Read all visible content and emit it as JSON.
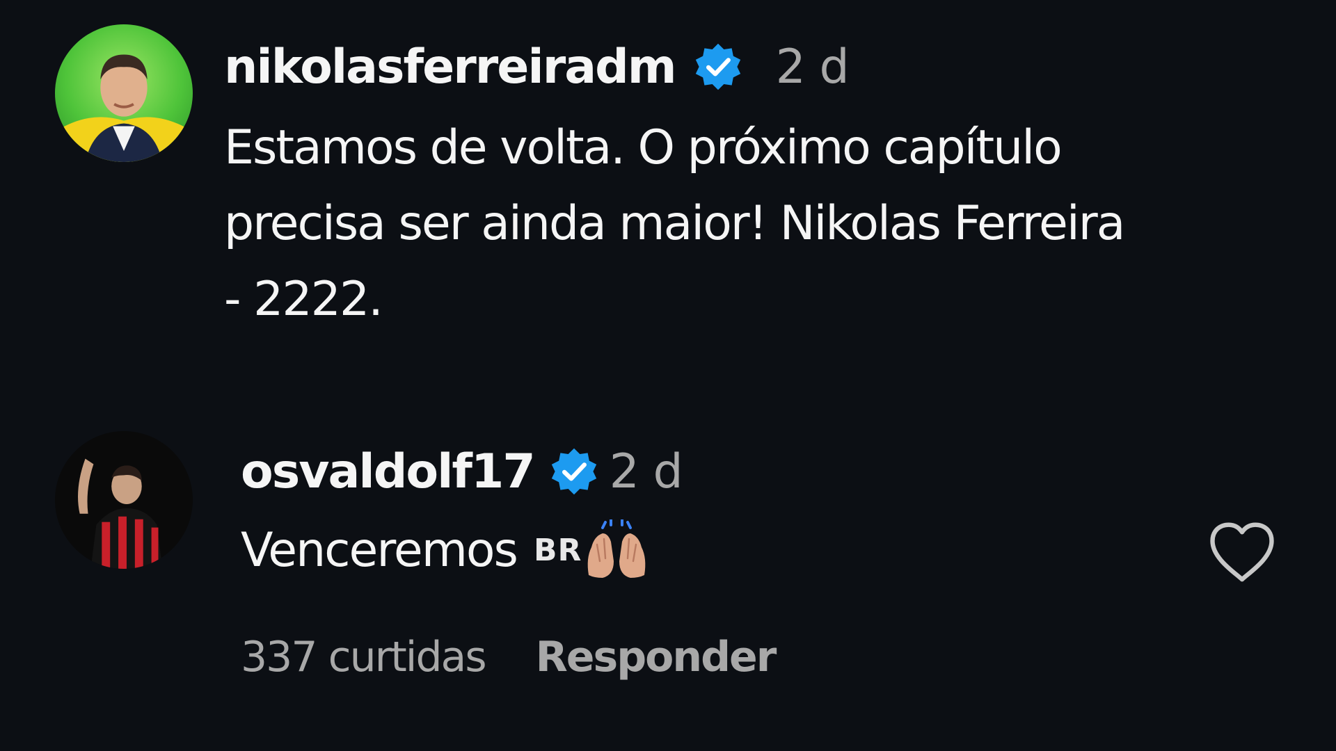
{
  "caption": {
    "username": "nikolasferreiradm",
    "verified": true,
    "timestamp": "2 d",
    "text": "Estamos de volta. O próximo capítulo\nprecisa ser ainda maior! Nikolas Ferreira\n- 2222."
  },
  "comment": {
    "username": "osvaldolf17",
    "verified": true,
    "timestamp": "2 d",
    "text": "Venceremos",
    "flag_letters": "BR",
    "emoji": "raising-hands-icon",
    "likes": "337 curtidas",
    "reply_label": "Responder"
  },
  "colors": {
    "background": "#0c0f14",
    "verified": "#1d9bf0",
    "secondary_text": "#a8a8a8"
  }
}
